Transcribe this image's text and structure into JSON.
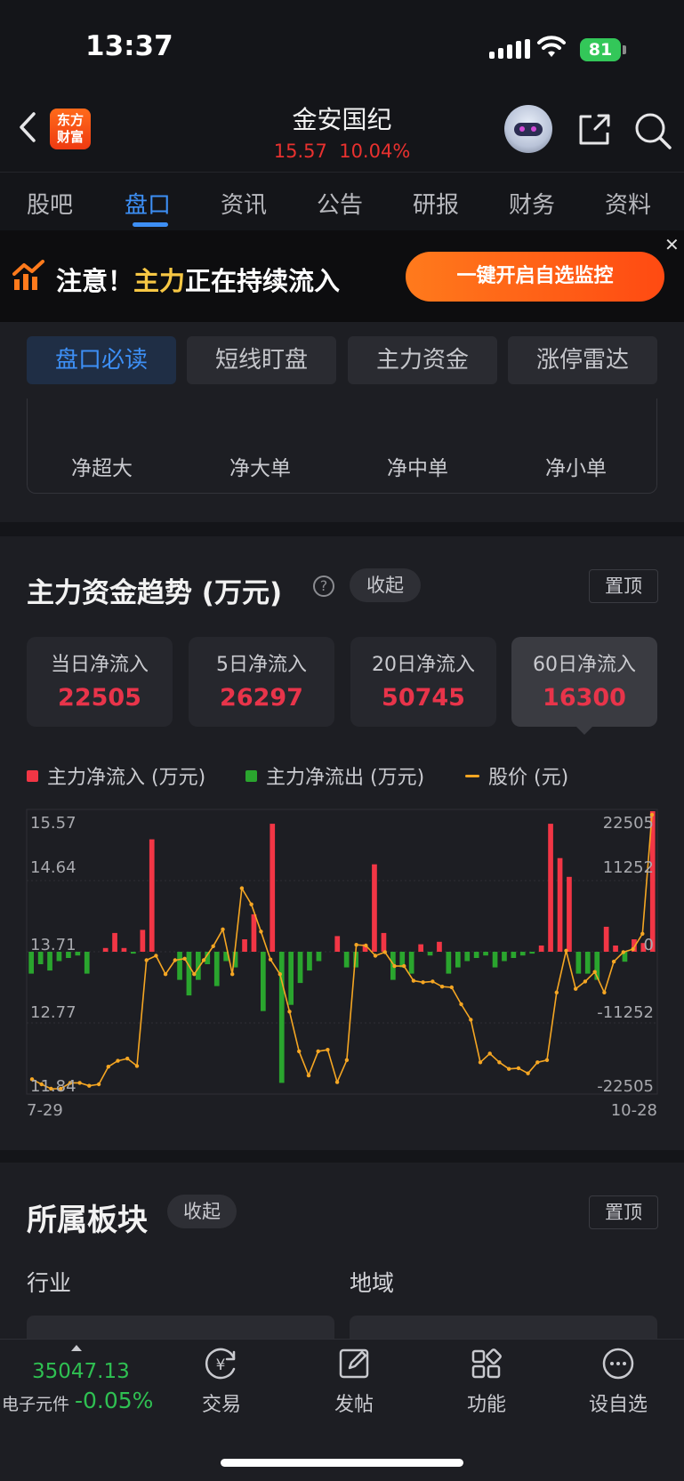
{
  "status": {
    "time": "13:37",
    "battery": "81"
  },
  "header": {
    "logo_line1": "东方",
    "logo_line2": "财富",
    "stock_name": "金安国纪",
    "price": "15.57",
    "change_pct": "10.04%"
  },
  "tabs": [
    {
      "label": "股吧",
      "active": false
    },
    {
      "label": "盘口",
      "active": true
    },
    {
      "label": "资讯",
      "active": false
    },
    {
      "label": "公告",
      "active": false
    },
    {
      "label": "研报",
      "active": false
    },
    {
      "label": "财务",
      "active": false
    },
    {
      "label": "资料",
      "active": false
    }
  ],
  "banner": {
    "text_prefix": "注意！",
    "text_highlight": "主力",
    "text_suffix": "正在持续流入",
    "button": "一键开启自选监控"
  },
  "subtabs": [
    {
      "label": "盘口必读",
      "active": true
    },
    {
      "label": "短线盯盘",
      "active": false
    },
    {
      "label": "主力资金",
      "active": false
    },
    {
      "label": "涨停雷达",
      "active": false
    }
  ],
  "flow_labels": [
    "净超大",
    "净大单",
    "净中单",
    "净小单"
  ],
  "trend": {
    "title": "主力资金趋势 (万元)",
    "collapse": "收起",
    "pin": "置顶",
    "cards": [
      {
        "label": "当日净流入",
        "value": "22505",
        "active": false
      },
      {
        "label": "5日净流入",
        "value": "26297",
        "active": false
      },
      {
        "label": "20日净流入",
        "value": "50745",
        "active": false
      },
      {
        "label": "60日净流入",
        "value": "16300",
        "active": true
      }
    ],
    "legend": {
      "inflow": "主力净流入 (万元)",
      "outflow": "主力净流出 (万元)",
      "price": "股价 (元)"
    },
    "colors": {
      "inflow": "#f23645",
      "outflow": "#2aa52e",
      "price": "#f5a623"
    }
  },
  "chart_data": {
    "type": "bar",
    "x_start": "7-29",
    "x_end": "10-28",
    "left_axis_ticks": [
      "15.57",
      "14.64",
      "13.71",
      "12.77",
      "11.84"
    ],
    "right_axis_ticks": [
      "22505",
      "11252",
      "0",
      "-11252",
      "-22505"
    ],
    "price_range": [
      11.84,
      15.57
    ],
    "flow_range": [
      -22505,
      22505
    ],
    "flows": [
      -3500,
      -2000,
      -3000,
      -1500,
      -1000,
      -600,
      -3500,
      0,
      600,
      3000,
      600,
      -300,
      3500,
      18000,
      0,
      0,
      -4500,
      -7000,
      -4500,
      -2000,
      -5500,
      -1500,
      -2500,
      2000,
      6000,
      -9500,
      20500,
      -21000,
      -8500,
      -5000,
      -3000,
      -1500,
      0,
      2500,
      -2500,
      -2500,
      1200,
      14000,
      3000,
      -4500,
      -2500,
      -3500,
      1200,
      -600,
      1600,
      -3500,
      -2500,
      -1500,
      -1000,
      -600,
      -2500,
      -1500,
      -1000,
      -600,
      -300,
      1000,
      20500,
      15000,
      12000,
      -3500,
      -3500,
      -4500,
      4000,
      1000,
      -1600,
      2000,
      1400,
      22500
    ],
    "prices": [
      11.97,
      11.9,
      11.84,
      11.84,
      11.92,
      11.92,
      11.88,
      11.9,
      12.14,
      12.22,
      12.25,
      12.15,
      13.59,
      13.65,
      13.4,
      13.59,
      13.61,
      13.4,
      13.59,
      13.78,
      14.01,
      13.4,
      14.57,
      14.35,
      13.98,
      13.6,
      13.4,
      12.89,
      12.35,
      12.02,
      12.35,
      12.37,
      11.93,
      12.23,
      13.8,
      13.79,
      13.65,
      13.7,
      13.51,
      13.51,
      13.31,
      13.29,
      13.3,
      13.23,
      13.22,
      12.99,
      12.78,
      12.2,
      12.32,
      12.2,
      12.11,
      12.12,
      12.05,
      12.2,
      12.23,
      13.15,
      13.72,
      13.2,
      13.3,
      13.43,
      13.15,
      13.57,
      13.7,
      13.74,
      13.95,
      15.57
    ]
  },
  "sectors": {
    "title": "所属板块",
    "collapse": "收起",
    "pin": "置顶",
    "industry_head": "行业",
    "region_head": "地域"
  },
  "bottom": {
    "index_value": "35047.13",
    "index_name": "电子元件",
    "index_change": "-0.05%",
    "items": [
      {
        "label": "交易",
        "icon": "yuan-refresh-icon"
      },
      {
        "label": "发帖",
        "icon": "edit-icon"
      },
      {
        "label": "功能",
        "icon": "grid-icon"
      },
      {
        "label": "设自选",
        "icon": "more-icon"
      }
    ]
  }
}
